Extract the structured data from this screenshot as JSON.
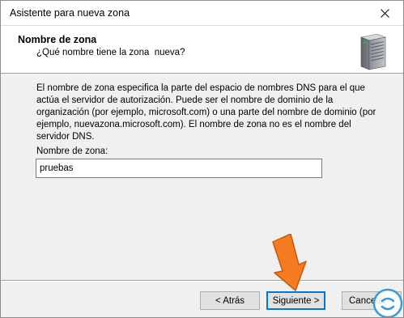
{
  "window": {
    "title": "Asistente para nueva zona",
    "close_icon": "close-icon"
  },
  "header": {
    "title": "Nombre de zona",
    "subtitle": "¿Qué nombre tiene la zona  nueva?",
    "icon": "server-icon"
  },
  "content": {
    "description": "El nombre de zona especifica la parte del espacio de nombres DNS para el que actúa el servidor de autorización. Puede ser el nombre de dominio de la organización (por ejemplo, microsoft.com) o una parte del nombre de dominio (por ejemplo, nuevazona.microsoft.com). El nombre de zona no es el nombre del servidor DNS.",
    "field_label": "Nombre de zona:",
    "field_value": "pruebas"
  },
  "buttons": {
    "back_label": "< Atrás",
    "next_label": "Siguiente >",
    "cancel_label": "Cancelar"
  },
  "overlay": {
    "arrow_icon": "orange-arrow-icon",
    "arrow_color": "#f47b20",
    "logo_icon": "logo-icon",
    "focus_color": "#0078d7"
  }
}
